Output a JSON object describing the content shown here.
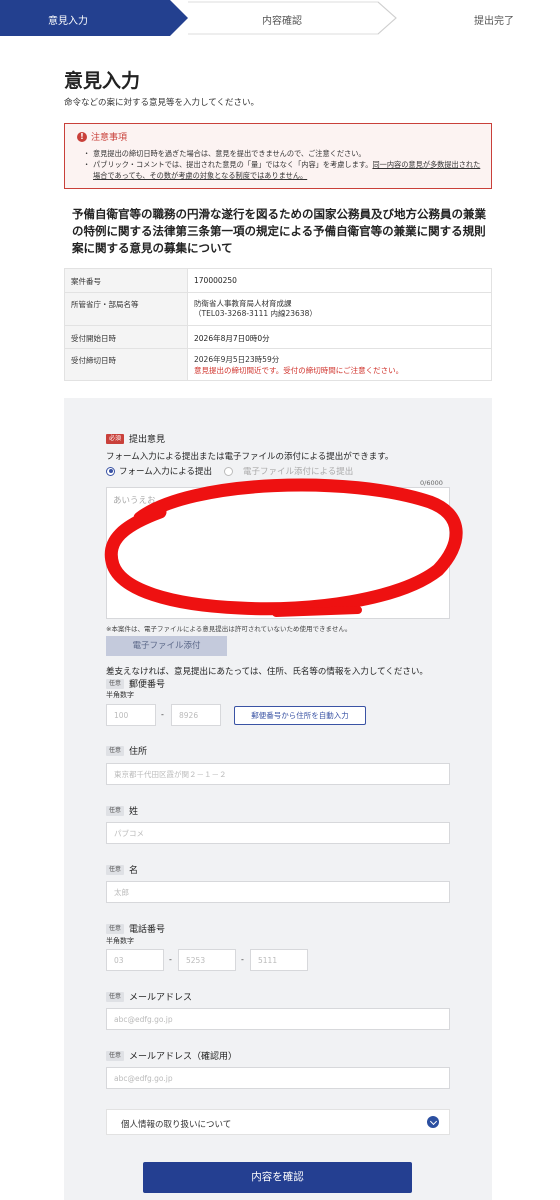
{
  "steps": [
    "意見入力",
    "内容確認",
    "提出完了"
  ],
  "page": {
    "title": "意見入力",
    "subtitle": "命令などの案に対する意見等を入力してください。"
  },
  "notice": {
    "icon": "exclamation-icon",
    "title": "注意事項",
    "items": [
      "意見提出の締切日時を過ぎた場合は、意見を提出できませんので、ご注意ください。",
      "パブリック・コメントでは、提出された意見の「量」ではなく「内容」を考慮します。",
      "同一内容の意見が多数提出された場合であっても、その数が考慮の対象となる制度ではありません。"
    ]
  },
  "case": {
    "title": "予備自衛官等の職務の円滑な遂行を図るための国家公務員及び地方公務員の兼業の特例に関する法律第三条第一項の規定による予備自衛官等の兼業に関する規則案に関する意見の募集について"
  },
  "info": {
    "case_number_label": "案件番号",
    "case_number": "170000250",
    "ministry_label": "所管省庁・部局名等",
    "ministry": "防衛省人事教育局人材育成課",
    "ministry_tel": "（TEL03-3268-3111 内線23638）",
    "start_label": "受付開始日時",
    "start": "2026年8月7日0時0分",
    "end_label": "受付締切日時",
    "end": "2026年9月5日23時59分",
    "end_warning": "意見提出の締切間近です。受付の締切時間にご注意ください。"
  },
  "form": {
    "required_badge": "必須",
    "optional_badge": "任意",
    "opinion_label": "提出意見",
    "method_desc": "フォーム入力による提出または電子ファイルの添付による提出ができます。",
    "radio_form": "フォーム入力による提出",
    "radio_file": "電子ファイル添付による提出",
    "counter": "0/6000",
    "opinion_placeholder": "あいうえお…",
    "file_note": "※本案件は、電子ファイルによる意見提出は許可されていないため使用できません。",
    "file_button": "電子ファイル添付",
    "optional_desc": "差支えなければ、意見提出にあたっては、住所、氏名等の情報を入力してください。",
    "zip_label": "郵便番号",
    "halfwidth_note": "半角数字",
    "zip1_placeholder": "100",
    "zip2_placeholder": "8926",
    "zip_button": "郵便番号から住所を自動入力",
    "address_label": "住所",
    "address_placeholder": "東京都千代田区霞が関２－１－２",
    "last_name_label": "姓",
    "last_name_placeholder": "パブコメ",
    "first_name_label": "名",
    "first_name_placeholder": "太郎",
    "phone_label": "電話番号",
    "phone1_placeholder": "03",
    "phone2_placeholder": "5253",
    "phone3_placeholder": "5111",
    "email_label": "メールアドレス",
    "email_placeholder": "abc@edfg.go.jp",
    "email_confirm_label": "メールアドレス（確認用）",
    "email_confirm_placeholder": "abc@edfg.go.jp",
    "privacy_label": "個人情報の取り扱いについて",
    "submit_label": "内容を確認"
  },
  "colors": {
    "primary": "#243f91",
    "warning": "#c9403a",
    "scribble": "#ee1111"
  }
}
